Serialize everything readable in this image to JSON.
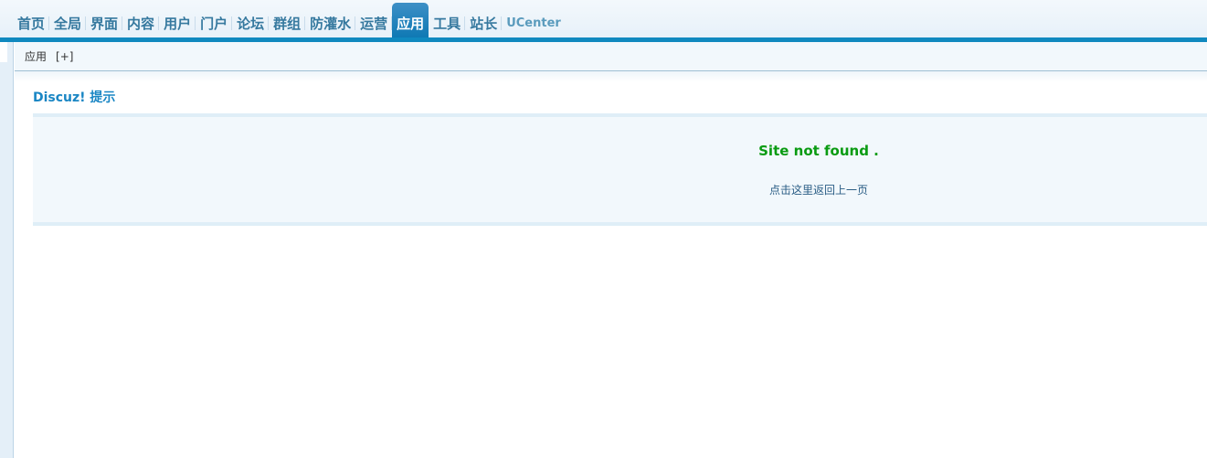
{
  "nav": {
    "items": [
      {
        "label": "首页"
      },
      {
        "label": "全局"
      },
      {
        "label": "界面"
      },
      {
        "label": "内容"
      },
      {
        "label": "用户"
      },
      {
        "label": "门户"
      },
      {
        "label": "论坛"
      },
      {
        "label": "群组"
      },
      {
        "label": "防灌水"
      },
      {
        "label": "运营"
      },
      {
        "label": "应用",
        "active": true
      },
      {
        "label": "工具"
      },
      {
        "label": "站长"
      },
      {
        "label": "UCenter"
      }
    ]
  },
  "subbar": {
    "crumb": "应用",
    "add_label": "[+]"
  },
  "message": {
    "title": "Discuz! 提示",
    "text": "Site not found .",
    "back_link": "点击这里返回上一页"
  },
  "colors": {
    "accent_blue": "#1089bf",
    "success_green": "#0a9b12",
    "title_blue": "#1a86c4"
  }
}
